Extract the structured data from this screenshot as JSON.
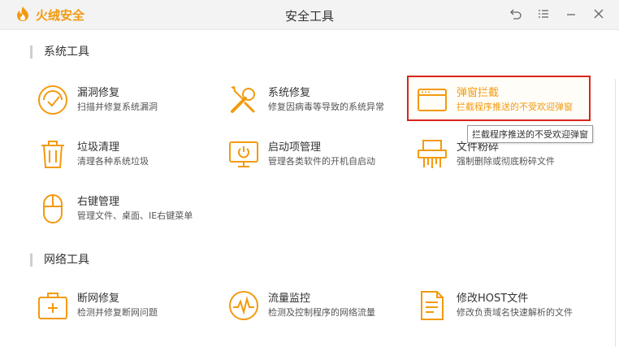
{
  "app": {
    "brand": "火绒安全",
    "window_title": "安全工具"
  },
  "colors": {
    "accent": "#f29a0f",
    "highlight_border": "#d9251d"
  },
  "window_controls": [
    {
      "name": "undo-icon"
    },
    {
      "name": "menu-icon"
    },
    {
      "name": "minimize-icon"
    },
    {
      "name": "close-icon"
    }
  ],
  "sections": {
    "system": {
      "title": "系统工具"
    },
    "network": {
      "title": "网络工具"
    }
  },
  "tools": {
    "leak_repair": {
      "name": "漏洞修复",
      "desc": "扫描并修复系统漏洞",
      "icon": "shield-check-icon"
    },
    "system_repair": {
      "name": "系统修复",
      "desc": "修复因病毒等导致的系统异常",
      "icon": "wrench-screwdriver-icon"
    },
    "popup_block": {
      "name": "弹窗拦截",
      "desc": "拦截程序推送的不受欢迎弹窗",
      "icon": "window-icon"
    },
    "junk_clean": {
      "name": "垃圾清理",
      "desc": "清理各种系统垃圾",
      "icon": "trash-icon"
    },
    "startup_mgmt": {
      "name": "启动项管理",
      "desc": "管理各类软件的开机自启动",
      "icon": "monitor-power-icon"
    },
    "file_shred": {
      "name": "文件粉碎",
      "desc": "强制删除或彻底粉碎文件",
      "icon": "shredder-icon"
    },
    "context_menu": {
      "name": "右键管理",
      "desc": "管理文件、桌面、IE右键菜单",
      "icon": "mouse-icon"
    },
    "net_repair": {
      "name": "断网修复",
      "desc": "检测并修复断网问题",
      "icon": "first-aid-icon"
    },
    "traffic_monitor": {
      "name": "流量监控",
      "desc": "检测及控制程序的网络流量",
      "icon": "pulse-gauge-icon"
    },
    "host_edit": {
      "name": "修改HOST文件",
      "desc": "修改负责域名快速解析的文件",
      "icon": "document-icon"
    }
  },
  "tooltip": {
    "text": "拦截程序推送的不受欢迎弹窗"
  }
}
